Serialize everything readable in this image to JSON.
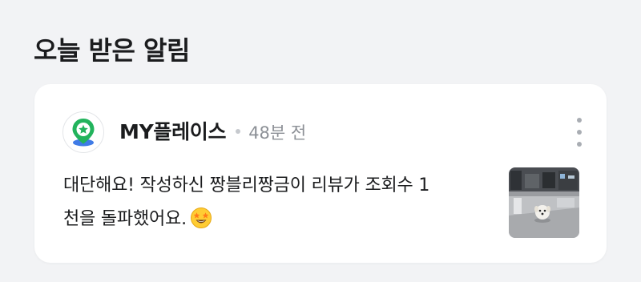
{
  "section": {
    "title": "오늘 받은 알림"
  },
  "notification": {
    "app_name": "MY플레이스",
    "time_ago": "48분 전",
    "message_line1": "대단해요! 작성하신 짱블리짱금이 리뷰가 조회수 1",
    "message_line2": "천을 돌파했어요.",
    "logo_icon": "map-pin-star-icon",
    "emoji_icon": "star-struck-emoji-icon",
    "thumbnail": "review-photo-dog-indoor",
    "more_icon": "more-vertical-icon"
  },
  "colors": {
    "background": "#f2f3f5",
    "card": "#ffffff",
    "title_text": "#1b1c1e",
    "muted_text": "#8c9096",
    "logo_green": "#22b35c",
    "logo_blue": "#3f7be6"
  }
}
